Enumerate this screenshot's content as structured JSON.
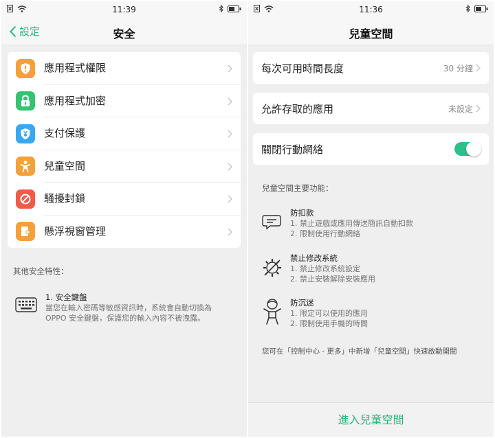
{
  "left": {
    "status": {
      "time": "11:39"
    },
    "nav": {
      "back_label": "設定",
      "title": "安全"
    },
    "items": [
      {
        "label": "應用程式權限",
        "icon": "shield-icon",
        "color": "#f5a03a"
      },
      {
        "label": "應用程式加密",
        "icon": "lock-icon",
        "color": "#35c372"
      },
      {
        "label": "支付保護",
        "icon": "yen-shield-icon",
        "color": "#3aa8f0"
      },
      {
        "label": "兒童空間",
        "icon": "child-icon",
        "color": "#f5a03a"
      },
      {
        "label": "騷擾封鎖",
        "icon": "block-icon",
        "color": "#f25a4a"
      },
      {
        "label": "懸浮視窗管理",
        "icon": "floating-window-icon",
        "color": "#f5a03a"
      }
    ],
    "other_label": "其他安全特性：",
    "feature": {
      "title": "1. 安全鍵盤",
      "line1": "當您在輸入密碼等敏感資訊時，系統會自動切換為",
      "line2": "OPPO 安全鍵盤，保護您的輸入內容不被洩露。"
    }
  },
  "right": {
    "status": {
      "time": "11:36"
    },
    "nav": {
      "title": "兒童空間"
    },
    "duration": {
      "label": "每次可用時間長度",
      "value": "30 分鐘"
    },
    "allowed": {
      "label": "允許存取的應用",
      "value": "未設定"
    },
    "mobile": {
      "label": "關閉行動網絡",
      "on": true
    },
    "main_label": "兒童空間主要功能：",
    "features": [
      {
        "title": "防扣款",
        "lines": [
          "1. 禁止遊戲或應用傳送簡訊自動扣款",
          "2. 限制使用行動網絡"
        ],
        "icon": "chat-bubbles-icon"
      },
      {
        "title": "禁止修改系統",
        "lines": [
          "1. 禁止修改系統設定",
          "2. 禁止安裝解除安裝應用"
        ],
        "icon": "gear-slash-icon"
      },
      {
        "title": "防沉迷",
        "lines": [
          "1. 限定可以使用的應用",
          "2. 限制使用手機的時間"
        ],
        "icon": "child-figure-icon"
      }
    ],
    "note": "您可在「控制中心 - 更多」中新增「兒童空間」快速啟動開關",
    "enter_label": "進入兒童空間"
  },
  "colors": {
    "accent": "#2ab47c",
    "toggle_on": "#2fbf8a"
  }
}
